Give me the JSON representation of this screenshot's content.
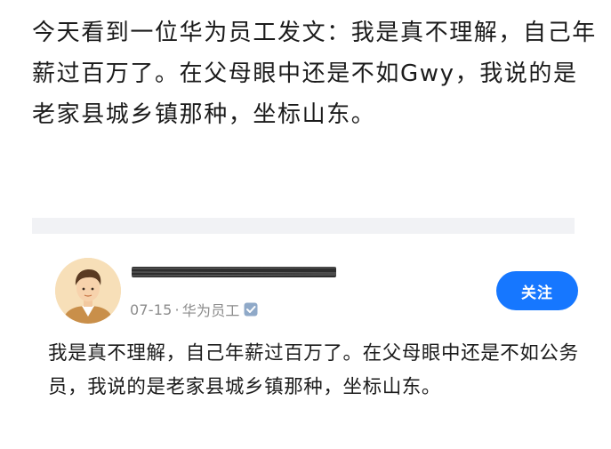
{
  "intro_text": "今天看到一位华为员工发文：我是真不理解，自己年薪过百万了。在父母眼中还是不如Gwy，我说的是老家县城乡镇那种，坐标山东。",
  "post": {
    "date": "07-15",
    "separator": "·",
    "company_tag": "华为员工",
    "verified_icon": "verified-badge-icon",
    "follow_label": "关注",
    "body": "我是真不理解，自己年薪过百万了。在父母眼中还是不如公务员，我说的是老家县城乡镇那种，坐标山东。"
  },
  "colors": {
    "accent": "#1677ff",
    "meta_gray": "#8c8c8c",
    "divider": "#f1f2f5"
  }
}
